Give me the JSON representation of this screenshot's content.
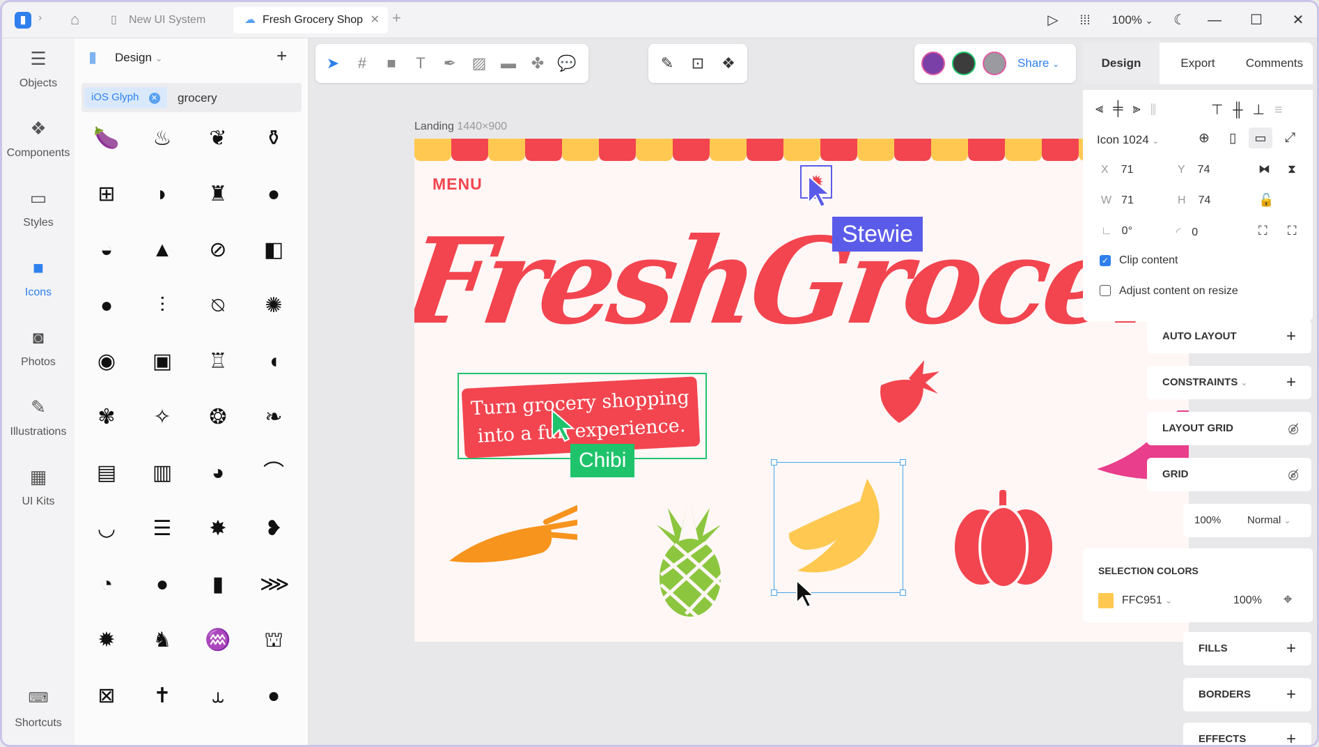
{
  "titlebar": {
    "tabs": [
      {
        "label": "New UI System"
      },
      {
        "label": "Fresh Grocery Shop"
      }
    ],
    "zoom": "100%"
  },
  "sidebar": {
    "items": [
      {
        "label": "Objects",
        "icon": "layers-icon"
      },
      {
        "label": "Components",
        "icon": "components-icon"
      },
      {
        "label": "Styles",
        "icon": "paint-roller-icon"
      },
      {
        "label": "Icons",
        "icon": "icons-icon"
      },
      {
        "label": "Photos",
        "icon": "camera-icon"
      },
      {
        "label": "Illustrations",
        "icon": "pen-nib-icon"
      },
      {
        "label": "UI Kits",
        "icon": "grid-icon"
      }
    ],
    "shortcuts": "Shortcuts"
  },
  "library": {
    "title": "Design",
    "filter_chip": "iOS Glyph",
    "search_value": "grocery"
  },
  "share": {
    "label": "Share"
  },
  "right_tabs": [
    "Design",
    "Export",
    "Comments"
  ],
  "inspector": {
    "layer_name": "Icon 1024",
    "x_label": "X",
    "x": "71",
    "y_label": "Y",
    "y": "74",
    "w_label": "W",
    "w": "71",
    "h_label": "H",
    "h": "74",
    "rotation": "0°",
    "radius": "0",
    "clip_content": "Clip content",
    "adjust_content": "Adjust content on resize"
  },
  "sections": {
    "auto_layout": "AUTO LAYOUT",
    "constraints": "CONSTRAINTS",
    "layout_grid": "LAYOUT GRID",
    "grid": "GRID",
    "opacity": "100%",
    "blend": "Normal",
    "selection_colors": "SELECTION COLORS",
    "color_hex": "FFC951",
    "color_opacity": "100%",
    "fills": "FILLS",
    "borders": "BORDERS",
    "effects": "EFFECTS"
  },
  "canvas": {
    "frame_label": "Landing",
    "frame_size": "1440×900",
    "menu": "MENU",
    "headline": "FreshGroceryShop",
    "tagline_line1": "Turn grocery shopping",
    "tagline_line2": "into a fun experience.",
    "cursor_stewie": "Stewie",
    "cursor_chibi": "Chibi"
  },
  "colors": {
    "accent": "#2f80ed",
    "brand_red": "#f2454f",
    "banana": "#FFC951",
    "stewie": "#5b5bea",
    "chibi": "#1fc36b"
  }
}
